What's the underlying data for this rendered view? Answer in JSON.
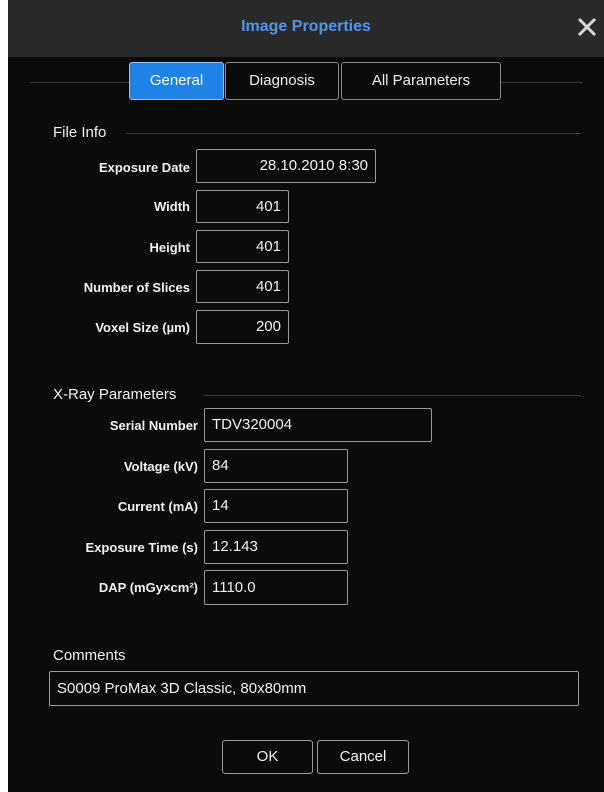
{
  "window": {
    "title": "Image Properties",
    "close_icon": "close-icon"
  },
  "tabs": [
    {
      "label": "General",
      "active": true
    },
    {
      "label": "Diagnosis",
      "active": false
    },
    {
      "label": "All Parameters",
      "active": false
    }
  ],
  "file_info": {
    "heading": "File Info",
    "fields": [
      {
        "label": "Exposure Date",
        "value": "28.10.2010 8:30"
      },
      {
        "label": "Width",
        "value": "401"
      },
      {
        "label": "Height",
        "value": "401"
      },
      {
        "label": "Number of Slices",
        "value": "401"
      },
      {
        "label": "Voxel Size (µm)",
        "value": "200"
      }
    ]
  },
  "xray": {
    "heading": "X-Ray Parameters",
    "fields": [
      {
        "label": "Serial Number",
        "value": "TDV320004"
      },
      {
        "label": "Voltage (kV)",
        "value": "84"
      },
      {
        "label": "Current (mA)",
        "value": "14"
      },
      {
        "label": "Exposure Time (s)",
        "value": "12.143"
      },
      {
        "label": "DAP (mGy×cm²)",
        "value": "1110.0"
      }
    ]
  },
  "comments": {
    "heading": "Comments",
    "value": "S0009 ProMax 3D Classic, 80x80mm"
  },
  "buttons": {
    "ok": "OK",
    "cancel": "Cancel"
  },
  "colors": {
    "title": "#4f97ee",
    "active_tab": "#1e82e6",
    "background": "#0b0b0b",
    "titlebar": "#292929"
  }
}
